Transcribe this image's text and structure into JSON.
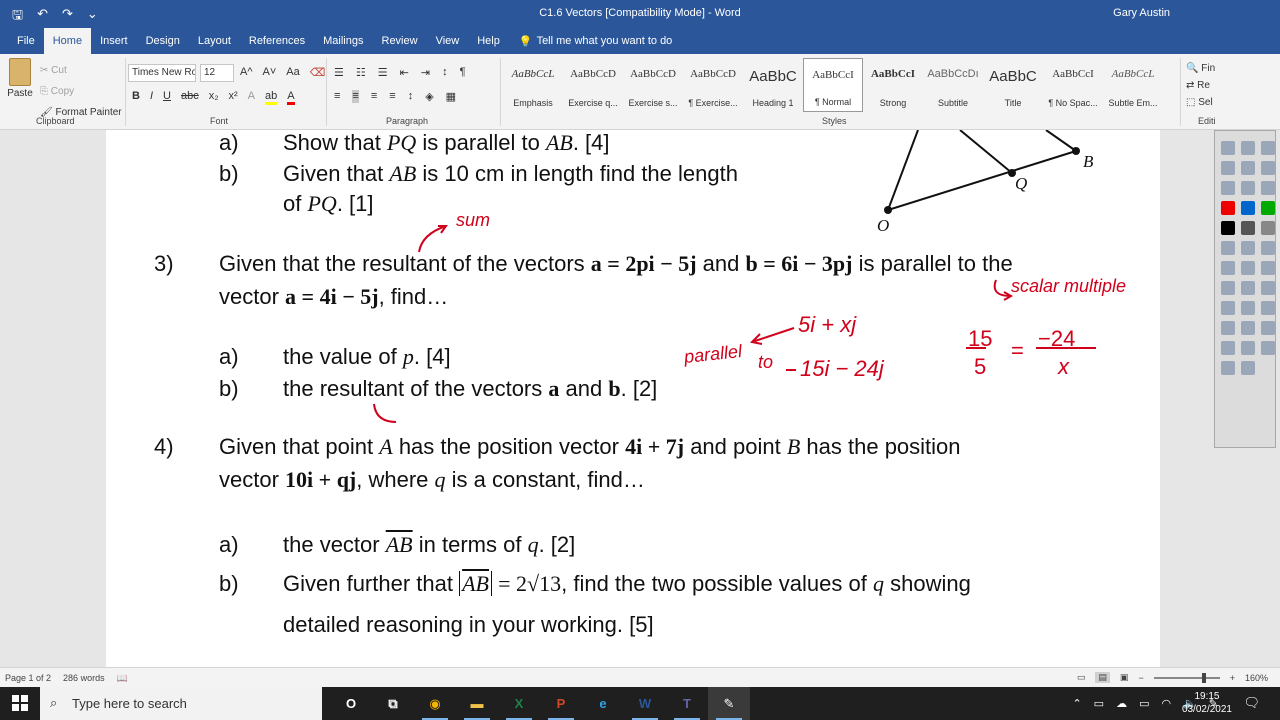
{
  "titlebar": {
    "title": "C1.6 Vectors [Compatibility Mode]  -  Word",
    "user": "Gary Austin",
    "save_icon": "save-icon",
    "undo_icon": "undo-icon",
    "redo_icon": "redo-icon"
  },
  "tabs": [
    "File",
    "Home",
    "Insert",
    "Design",
    "Layout",
    "References",
    "Mailings",
    "Review",
    "View",
    "Help"
  ],
  "tellme": "Tell me what you want to do",
  "ribbon": {
    "clipboard": {
      "paste": "Paste",
      "cut": "Cut",
      "copy": "Copy",
      "format_painter": "Format Painter",
      "label": "Clipboard"
    },
    "font": {
      "name": "Times New Ro",
      "size": "12",
      "label": "Font",
      "grow": "A^",
      "shrink": "A˅",
      "case": "Aa"
    },
    "paragraph": {
      "label": "Paragraph"
    },
    "styles_label": "Styles",
    "editing_label": "Editi",
    "find": "Fin",
    "replace": "Re",
    "select": "Sel",
    "styles": [
      {
        "sample": "AaBbCcL",
        "name": "Emphasis"
      },
      {
        "sample": "AaBbCcD",
        "name": "Exercise q..."
      },
      {
        "sample": "AaBbCcD",
        "name": "Exercise s..."
      },
      {
        "sample": "AaBbCcD",
        "name": "¶ Exercise..."
      },
      {
        "sample": "AaBbC",
        "name": "Heading 1"
      },
      {
        "sample": "AaBbCcI",
        "name": "¶ Normal"
      },
      {
        "sample": "AaBbCcI",
        "name": "Strong"
      },
      {
        "sample": "AaBbCcDı",
        "name": "Subtitle"
      },
      {
        "sample": "AaBbC",
        "name": "Title"
      },
      {
        "sample": "AaBbCcI",
        "name": "¶ No Spac..."
      },
      {
        "sample": "AaBbCcL",
        "name": "Subtle Em..."
      }
    ]
  },
  "doc": {
    "q2a_label": "a)",
    "q2a_text": "Show that",
    "q2a_pq": "PQ",
    "q2a_mid": "is parallel to",
    "q2a_ab": "AB",
    "q2a_mark": ". [4]",
    "q2b_label": "b)",
    "q2b_text": "Given that",
    "q2b_ab": "AB",
    "q2b_mid": "is 10 cm in length find the length",
    "q2b_cont": "of",
    "q2b_pq": "PQ",
    "q2b_mark": ". [1]",
    "fig_o": "O",
    "fig_q": "Q",
    "fig_b": "B",
    "q3_num": "3)",
    "q3_line1a": "Given that the resultant of the vectors",
    "q3_a_vec": "a = 2pi − 5j",
    "q3_and": "and",
    "q3_b_vec": "b = 6i − 3pj",
    "q3_line1b": "is parallel to the",
    "q3_line2a": "vector",
    "q3_v_vec": "a = 4i − 5j",
    "q3_line2b": ", find…",
    "q3a_label": "a)",
    "q3a_text": "the value of",
    "q3a_p": "p",
    "q3a_mark": ". [4]",
    "q3b_label": "b)",
    "q3b_text": "the resultant of the vectors",
    "q3b_a": "a",
    "q3b_and": "and",
    "q3b_b": "b",
    "q3b_mark": ". [2]",
    "q4_num": "4)",
    "q4_line1a": "Given that point",
    "q4_A": "A",
    "q4_mid1": "has the position vector",
    "q4_vecA": "4i + 7j",
    "q4_mid2": "and point",
    "q4_B": "B",
    "q4_line1b": "has the position",
    "q4_line2a": "vector",
    "q4_vecB": "10i + qj",
    "q4_line2b": ", where",
    "q4_q": "q",
    "q4_line2c": "is a constant, find…",
    "q4a_label": "a)",
    "q4a_text": "the vector",
    "q4a_ab": "AB",
    "q4a_mid": "in terms of",
    "q4a_q": "q",
    "q4a_mark": ". [2]",
    "q4b_label": "b)",
    "q4b_text": "Given further that",
    "q4b_ab": "AB",
    "q4b_eq": "= 2√13",
    "q4b_rest": ", find the two possible values of",
    "q4b_q": "q",
    "q4b_rest2": "showing",
    "q4b_cont": "detailed reasoning in your working. [5]"
  },
  "annotations": {
    "sum": "sum",
    "scalar": "scalar multiple",
    "parallel": "parallel",
    "to": "to",
    "vec1": "5i + xj",
    "vec2": "15i − 24j",
    "frac_top_left": "15",
    "frac_bottom_left": "5",
    "frac_eq": "=",
    "frac_top_right": "−24",
    "frac_bottom_right": "x",
    "ink_color": "#d0021b"
  },
  "status": {
    "page": "Page 1 of 2",
    "words": "286 words",
    "zoom": "160%",
    "zoom_minus": "−",
    "zoom_plus": "+"
  },
  "taskbar": {
    "search_placeholder": "Type here to search",
    "time": "19:15",
    "date": "03/02/2021",
    "apps": [
      "O",
      "⧉",
      "◉",
      "▬",
      "X",
      "P",
      "e",
      "W",
      "T",
      "✎"
    ]
  }
}
